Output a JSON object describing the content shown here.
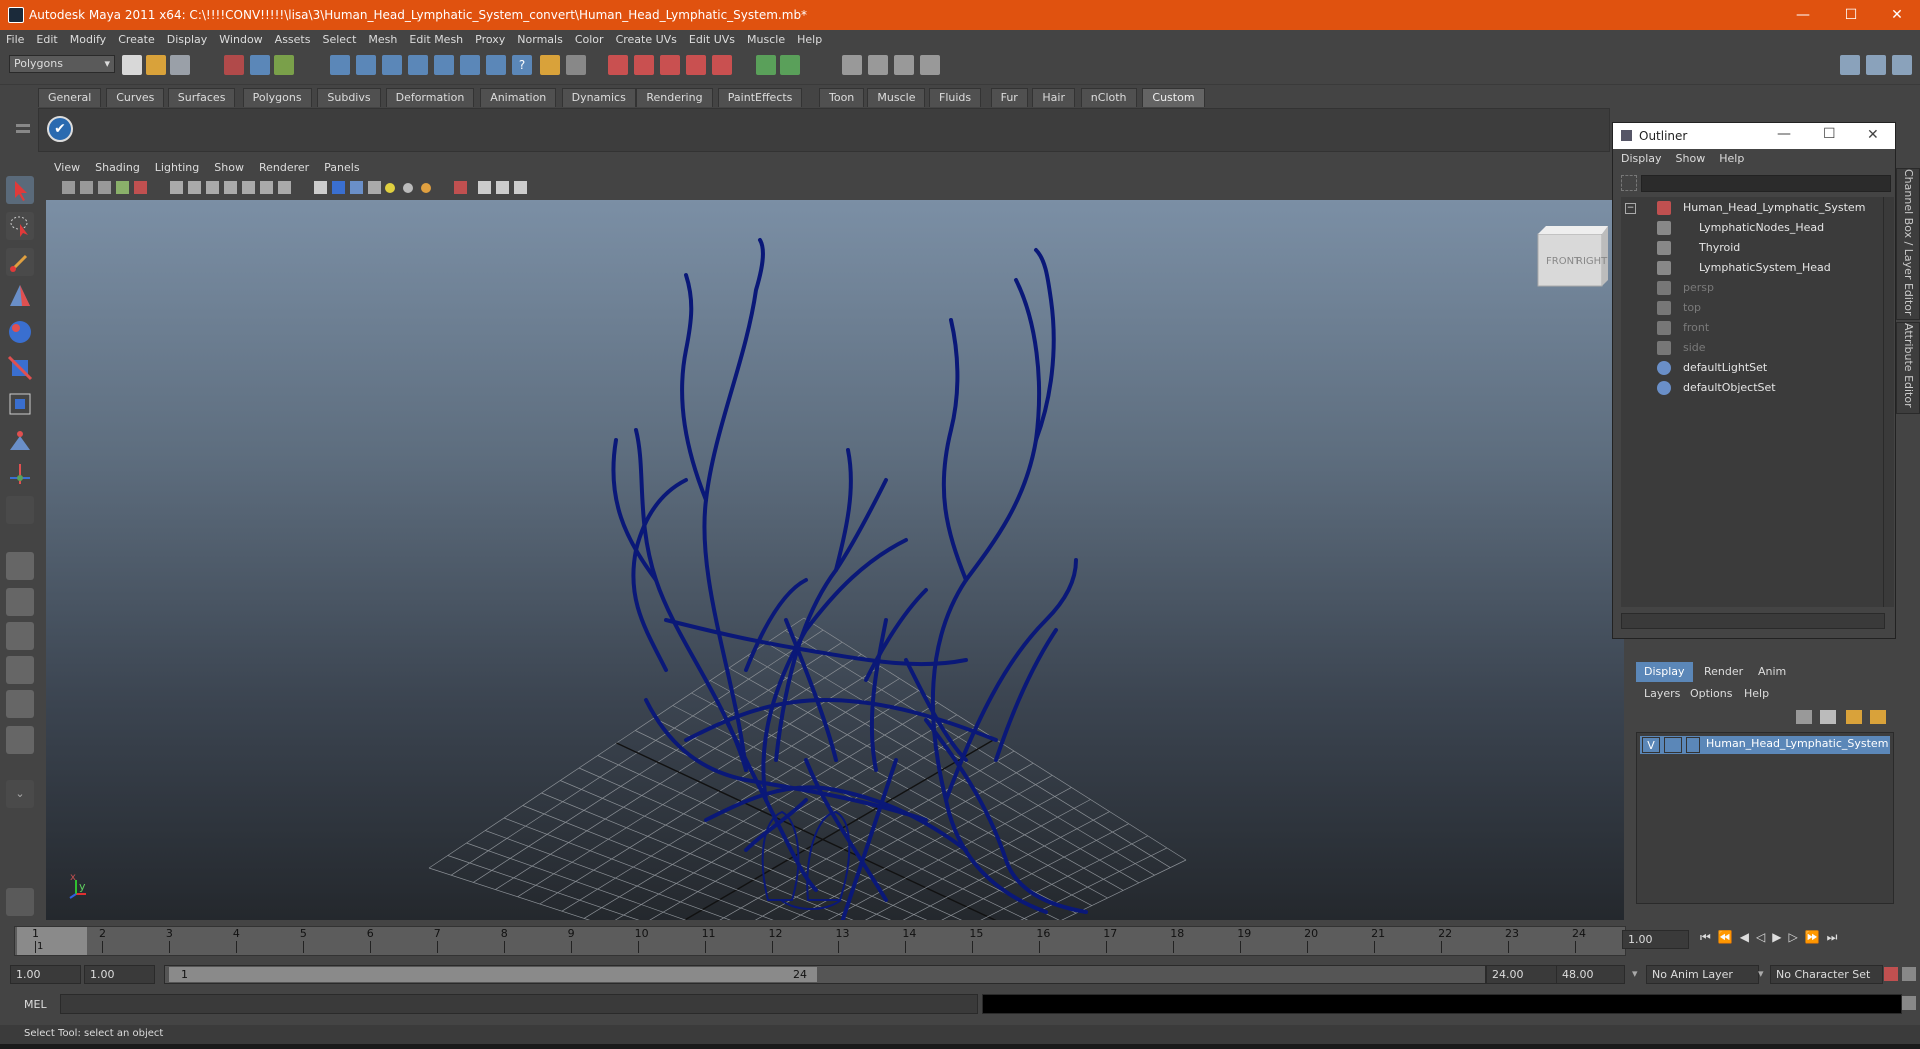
{
  "window": {
    "title": "Autodesk Maya 2011 x64: C:\\!!!!CONV!!!!!\\lisa\\3\\Human_Head_Lymphatic_System_convert\\Human_Head_Lymphatic_System.mb*",
    "minimize": "—",
    "maximize": "☐",
    "close": "✕"
  },
  "menubar": [
    "File",
    "Edit",
    "Modify",
    "Create",
    "Display",
    "Window",
    "Assets",
    "Select",
    "Mesh",
    "Edit Mesh",
    "Proxy",
    "Normals",
    "Color",
    "Create UVs",
    "Edit UVs",
    "Muscle",
    "Help"
  ],
  "status_line": {
    "mode": "Polygons"
  },
  "shelf_tabs": [
    "General",
    "Curves",
    "Surfaces",
    "Polygons",
    "Subdivs",
    "Deformation",
    "Animation",
    "Dynamics",
    "Rendering",
    "PaintEffects",
    "Toon",
    "Muscle",
    "Fluids",
    "Fur",
    "Hair",
    "nCloth",
    "Custom"
  ],
  "active_shelf": "Custom",
  "viewport": {
    "menu": [
      "View",
      "Shading",
      "Lighting",
      "Show",
      "Renderer",
      "Panels"
    ],
    "viewcube_front": "FRONT",
    "viewcube_right": "RIGHT",
    "axis_x": "x",
    "axis_y": "y"
  },
  "outliner": {
    "title": "Outliner",
    "menu": [
      "Display",
      "Show",
      "Help"
    ],
    "items": [
      {
        "label": "Human_Head_Lymphatic_System",
        "depth": 0,
        "dim": false
      },
      {
        "label": "LymphaticNodes_Head",
        "depth": 1,
        "dim": false
      },
      {
        "label": "Thyroid",
        "depth": 1,
        "dim": false
      },
      {
        "label": "LymphaticSystem_Head",
        "depth": 1,
        "dim": false
      },
      {
        "label": "persp",
        "depth": 0,
        "dim": true
      },
      {
        "label": "top",
        "depth": 0,
        "dim": true
      },
      {
        "label": "front",
        "depth": 0,
        "dim": true
      },
      {
        "label": "side",
        "depth": 0,
        "dim": true
      },
      {
        "label": "defaultLightSet",
        "depth": 0,
        "dim": false
      },
      {
        "label": "defaultObjectSet",
        "depth": 0,
        "dim": false
      }
    ]
  },
  "channel_box": {
    "tabs": [
      "Display",
      "Render",
      "Anim"
    ],
    "menu": [
      "Layers",
      "Options",
      "Help"
    ],
    "layer": {
      "visible": "V",
      "name": "Human_Head_Lymphatic_System_layer"
    }
  },
  "side_tabs": {
    "channel": "Channel Box / Layer Editor",
    "attribute": "Attribute Editor"
  },
  "timeline": {
    "ticks": [
      "1",
      "2",
      "3",
      "4",
      "5",
      "6",
      "7",
      "8",
      "9",
      "10",
      "11",
      "12",
      "13",
      "14",
      "15",
      "16",
      "17",
      "18",
      "19",
      "20",
      "21",
      "22",
      "23",
      "24"
    ],
    "current_frame_marker": "1",
    "current_time": "1.00"
  },
  "range": {
    "start": "1.00",
    "playback_start": "1.00",
    "slider_start": "1",
    "slider_end": "24",
    "playback_end": "24.00",
    "end": "48.00",
    "anim_layer": "No Anim Layer",
    "character_set": "No Character Set"
  },
  "command_line": {
    "label": "MEL"
  },
  "help_line": {
    "text": "Select Tool: select an object"
  },
  "colors": {
    "titlebar": "#e0520f",
    "wireframe": "#0a1878",
    "accent": "#5b87b8"
  }
}
